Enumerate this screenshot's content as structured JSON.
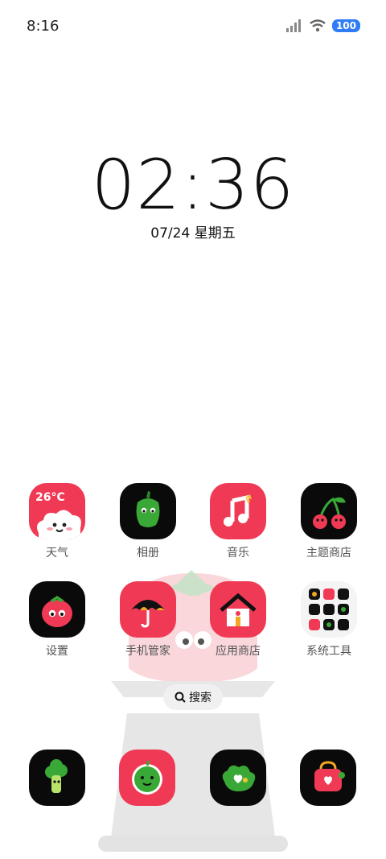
{
  "status_bar": {
    "time": "8:16",
    "battery": "100"
  },
  "lockscreen": {
    "clock": "02:36",
    "date": "07/24 星期五"
  },
  "apps": [
    {
      "id": "weather",
      "label": "天气",
      "badge_text": "26°C"
    },
    {
      "id": "photos",
      "label": "相册"
    },
    {
      "id": "music",
      "label": "音乐"
    },
    {
      "id": "theme-store",
      "label": "主题商店"
    },
    {
      "id": "settings",
      "label": "设置"
    },
    {
      "id": "phone-manager",
      "label": "手机管家"
    },
    {
      "id": "app-store",
      "label": "应用商店"
    },
    {
      "id": "system-tools",
      "label": "系统工具"
    }
  ],
  "search": {
    "label": "搜索"
  },
  "colors": {
    "accent_red": "#f03a55",
    "black": "#0a0a0a",
    "green": "#3aa836",
    "battery_blue": "#2f7cf6"
  }
}
